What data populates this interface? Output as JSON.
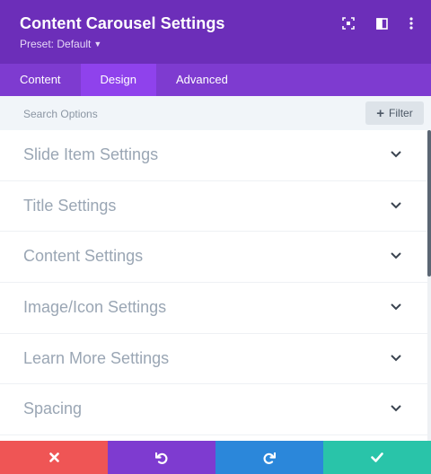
{
  "header": {
    "title": "Content Carousel Settings",
    "preset": "Preset: Default",
    "icons": [
      "focus-icon",
      "split-view-icon",
      "more-vertical-icon"
    ],
    "bg_color": "#6c2eb9"
  },
  "tabs": {
    "items": [
      {
        "label": "Content"
      },
      {
        "label": "Design"
      },
      {
        "label": "Advanced"
      }
    ],
    "active": "Design"
  },
  "search": {
    "placeholder": "Search Options",
    "filter_label": "Filter"
  },
  "sections": [
    {
      "label": "Slide Item Settings"
    },
    {
      "label": "Title Settings"
    },
    {
      "label": "Content Settings"
    },
    {
      "label": "Image/Icon Settings"
    },
    {
      "label": "Learn More Settings"
    },
    {
      "label": "Spacing"
    }
  ],
  "footer": {
    "buttons": [
      {
        "name": "cancel",
        "icon": "close-icon",
        "color": "#ef5555"
      },
      {
        "name": "undo",
        "icon": "undo-icon",
        "color": "#7e3bd0"
      },
      {
        "name": "redo",
        "icon": "redo-icon",
        "color": "#2b87da"
      },
      {
        "name": "save",
        "icon": "check-icon",
        "color": "#29c4a9"
      }
    ]
  }
}
